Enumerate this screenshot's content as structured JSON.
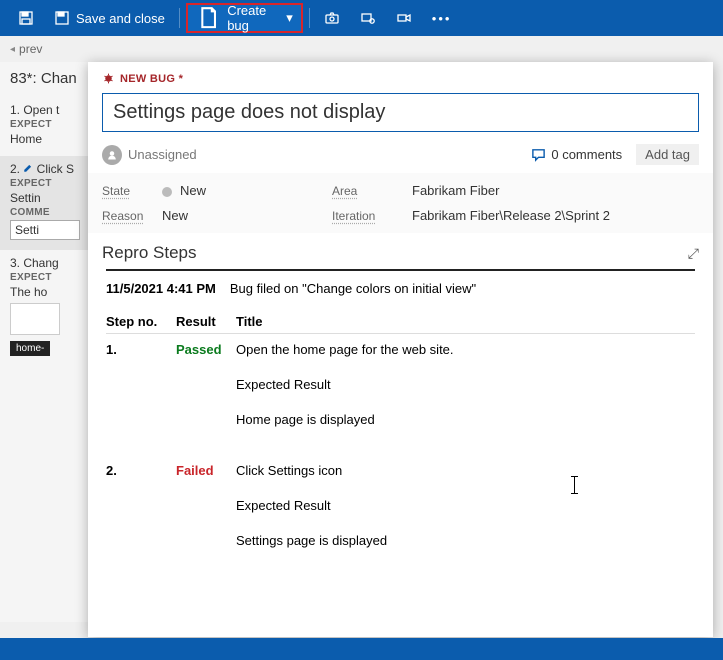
{
  "toolbar": {
    "save_close": "Save and close",
    "create_bug": "Create bug"
  },
  "breadcrumb": {
    "prev": "prev"
  },
  "left": {
    "case": "83*: Chan",
    "steps": [
      {
        "num": "1.",
        "title": "Open t",
        "expectLbl": "EXPECT",
        "expect": "Home"
      },
      {
        "num": "2.",
        "title": "Click S",
        "expectLbl": "EXPECT",
        "expect": "Settin",
        "commLbl": "COMME",
        "comm": "Setti"
      },
      {
        "num": "3.",
        "title": "Chang",
        "expectLbl": "EXPECT",
        "expect": "The ho",
        "badge": "home-"
      }
    ]
  },
  "bug": {
    "header": "NEW BUG *",
    "title": "Settings page does not display",
    "assignee": "Unassigned",
    "comments": "0 comments",
    "addtag": "Add tag",
    "fields": {
      "state_lbl": "State",
      "state": "New",
      "area_lbl": "Area",
      "area": "Fabrikam Fiber",
      "reason_lbl": "Reason",
      "reason": "New",
      "iter_lbl": "Iteration",
      "iter": "Fabrikam Fiber\\Release 2\\Sprint 2"
    },
    "repro": {
      "heading": "Repro Steps",
      "timestamp": "11/5/2021 4:41 PM",
      "context": "Bug filed on \"Change colors on initial view\"",
      "cols": {
        "step": "Step no.",
        "result": "Result",
        "title": "Title"
      },
      "rows": [
        {
          "num": "1.",
          "result": "Passed",
          "resClass": "res-pass",
          "title": "Open the home page for the web site.",
          "erLbl": "Expected Result",
          "er": "Home page is displayed"
        },
        {
          "num": "2.",
          "result": "Failed",
          "resClass": "res-fail",
          "title": "Click Settings icon",
          "erLbl": "Expected Result",
          "er": "Settings page is displayed"
        }
      ]
    }
  }
}
